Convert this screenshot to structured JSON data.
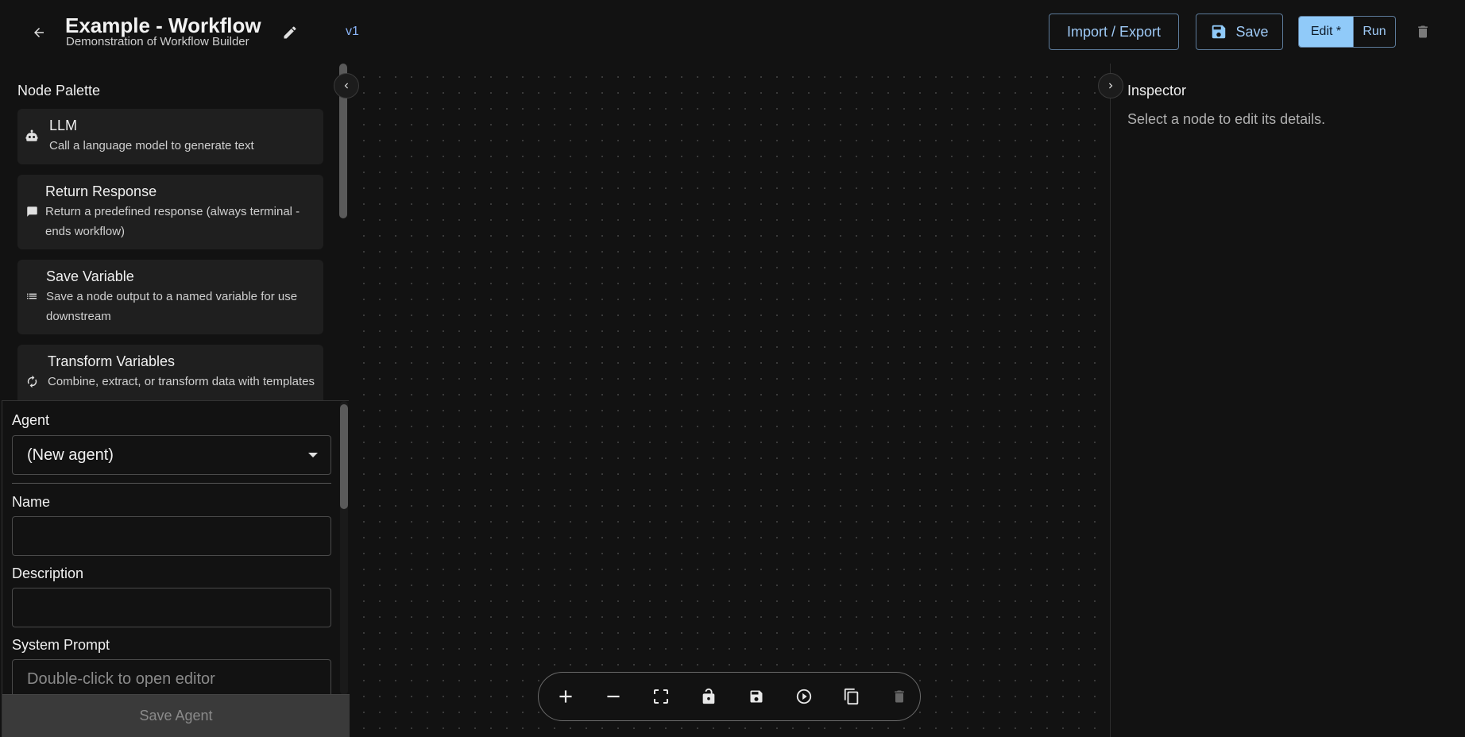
{
  "header": {
    "title": "Example - Workflow",
    "subtitle": "Demonstration of Workflow Builder",
    "version": "v1",
    "import_export_label": "Import / Export",
    "save_label": "Save",
    "mode_edit_label": "Edit *",
    "mode_run_label": "Run"
  },
  "palette": {
    "title": "Node Palette",
    "nodes": [
      {
        "title": "LLM",
        "description": "Call a language model to generate text",
        "icon": "robot-icon"
      },
      {
        "title": "Return Response",
        "description": "Return a predefined response (always terminal - ends workflow)",
        "icon": "chat-icon"
      },
      {
        "title": "Save Variable",
        "description": "Save a node output to a named variable for use downstream",
        "icon": "list-icon"
      },
      {
        "title": "Transform Variables",
        "description": "Combine, extract, or transform data with templates",
        "icon": "refresh-icon"
      }
    ]
  },
  "agent_form": {
    "agent_label": "Agent",
    "agent_selected": "(New agent)",
    "name_label": "Name",
    "name_value": "",
    "description_label": "Description",
    "description_value": "",
    "system_prompt_label": "System Prompt",
    "system_prompt_placeholder": "Double-click to open editor",
    "save_agent_label": "Save Agent"
  },
  "inspector": {
    "title": "Inspector",
    "hint": "Select a node to edit its details."
  },
  "toolbar": {
    "tools": [
      "zoom-in-icon",
      "zoom-out-icon",
      "fit-view-icon",
      "lock-icon",
      "save-icon",
      "play-icon",
      "copy-icon",
      "delete-icon"
    ]
  },
  "colors": {
    "background": "#121212",
    "accent": "#90caf9",
    "card": "#1f1f1f"
  }
}
